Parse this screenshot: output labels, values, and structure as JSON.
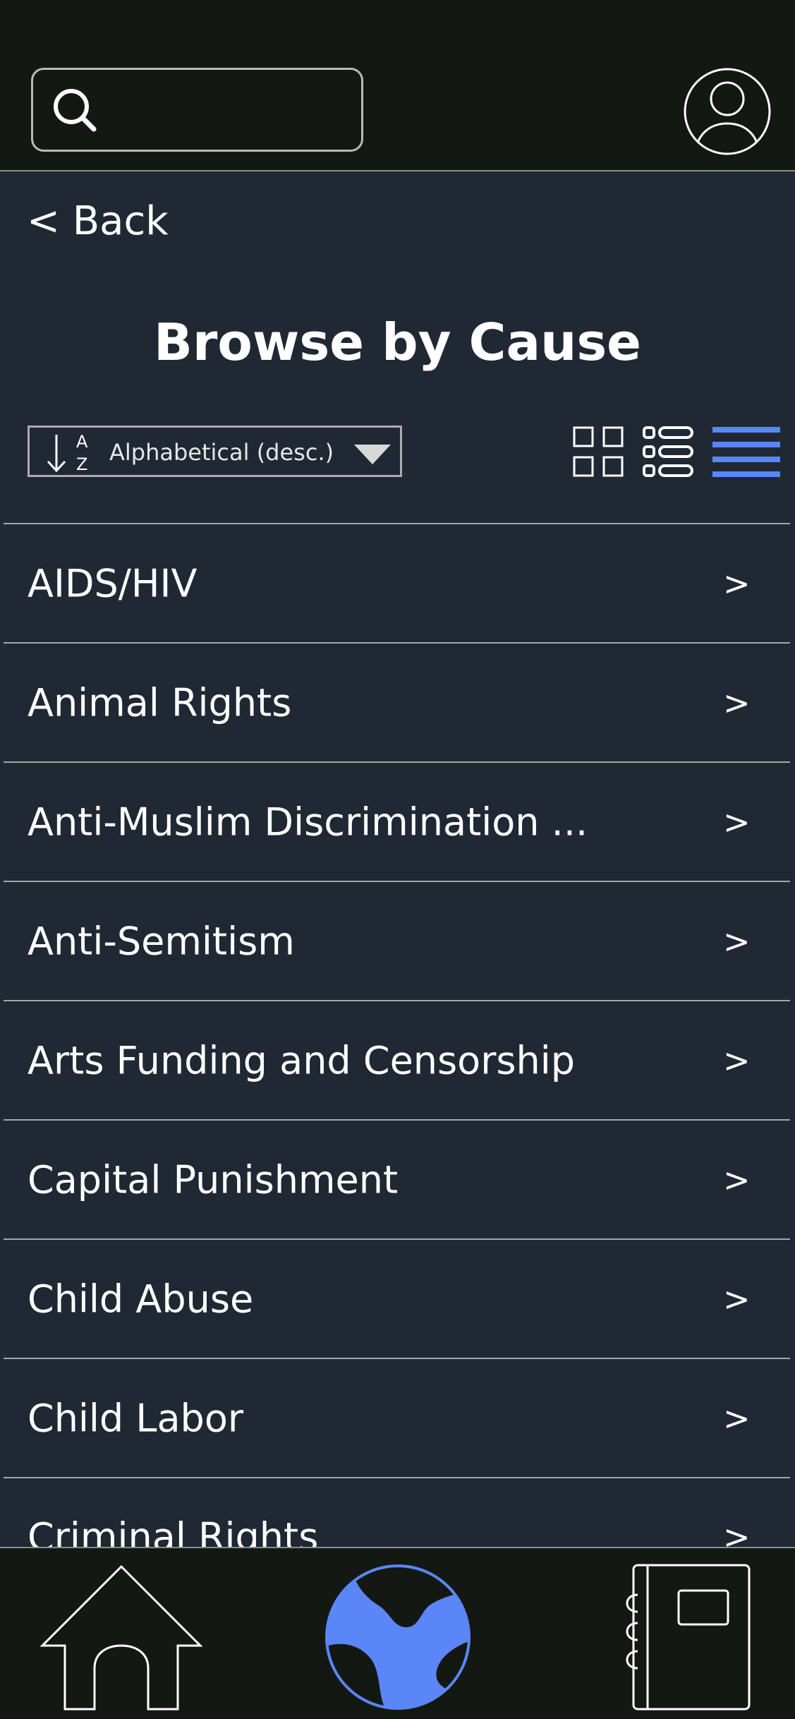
{
  "header": {
    "search": {
      "placeholder": "",
      "value": ""
    }
  },
  "nav": {
    "back_label": "< Back"
  },
  "page": {
    "title": "Browse by Cause"
  },
  "controls": {
    "sort": {
      "selected": "Alphabetical (desc.)",
      "icon_letters": [
        "A",
        "Z"
      ]
    },
    "active_view": "list",
    "accent_color": "#5b86f7"
  },
  "causes": [
    {
      "name": "AIDS/HIV",
      "chevron": ">"
    },
    {
      "name": "Animal Rights",
      "chevron": ">"
    },
    {
      "name": "Anti-Muslim Discrimination ...",
      "chevron": ">"
    },
    {
      "name": "Anti-Semitism",
      "chevron": ">"
    },
    {
      "name": "Arts Funding and Censorship",
      "chevron": ">"
    },
    {
      "name": "Capital Punishment",
      "chevron": ">"
    },
    {
      "name": "Child Abuse",
      "chevron": ">"
    },
    {
      "name": "Child Labor",
      "chevron": ">"
    },
    {
      "name": "Criminal Rights",
      "chevron": ">"
    }
  ],
  "bottom_nav": {
    "items": [
      {
        "icon": "home-icon"
      },
      {
        "icon": "globe-icon",
        "active": true
      },
      {
        "icon": "notebook-icon"
      }
    ]
  }
}
